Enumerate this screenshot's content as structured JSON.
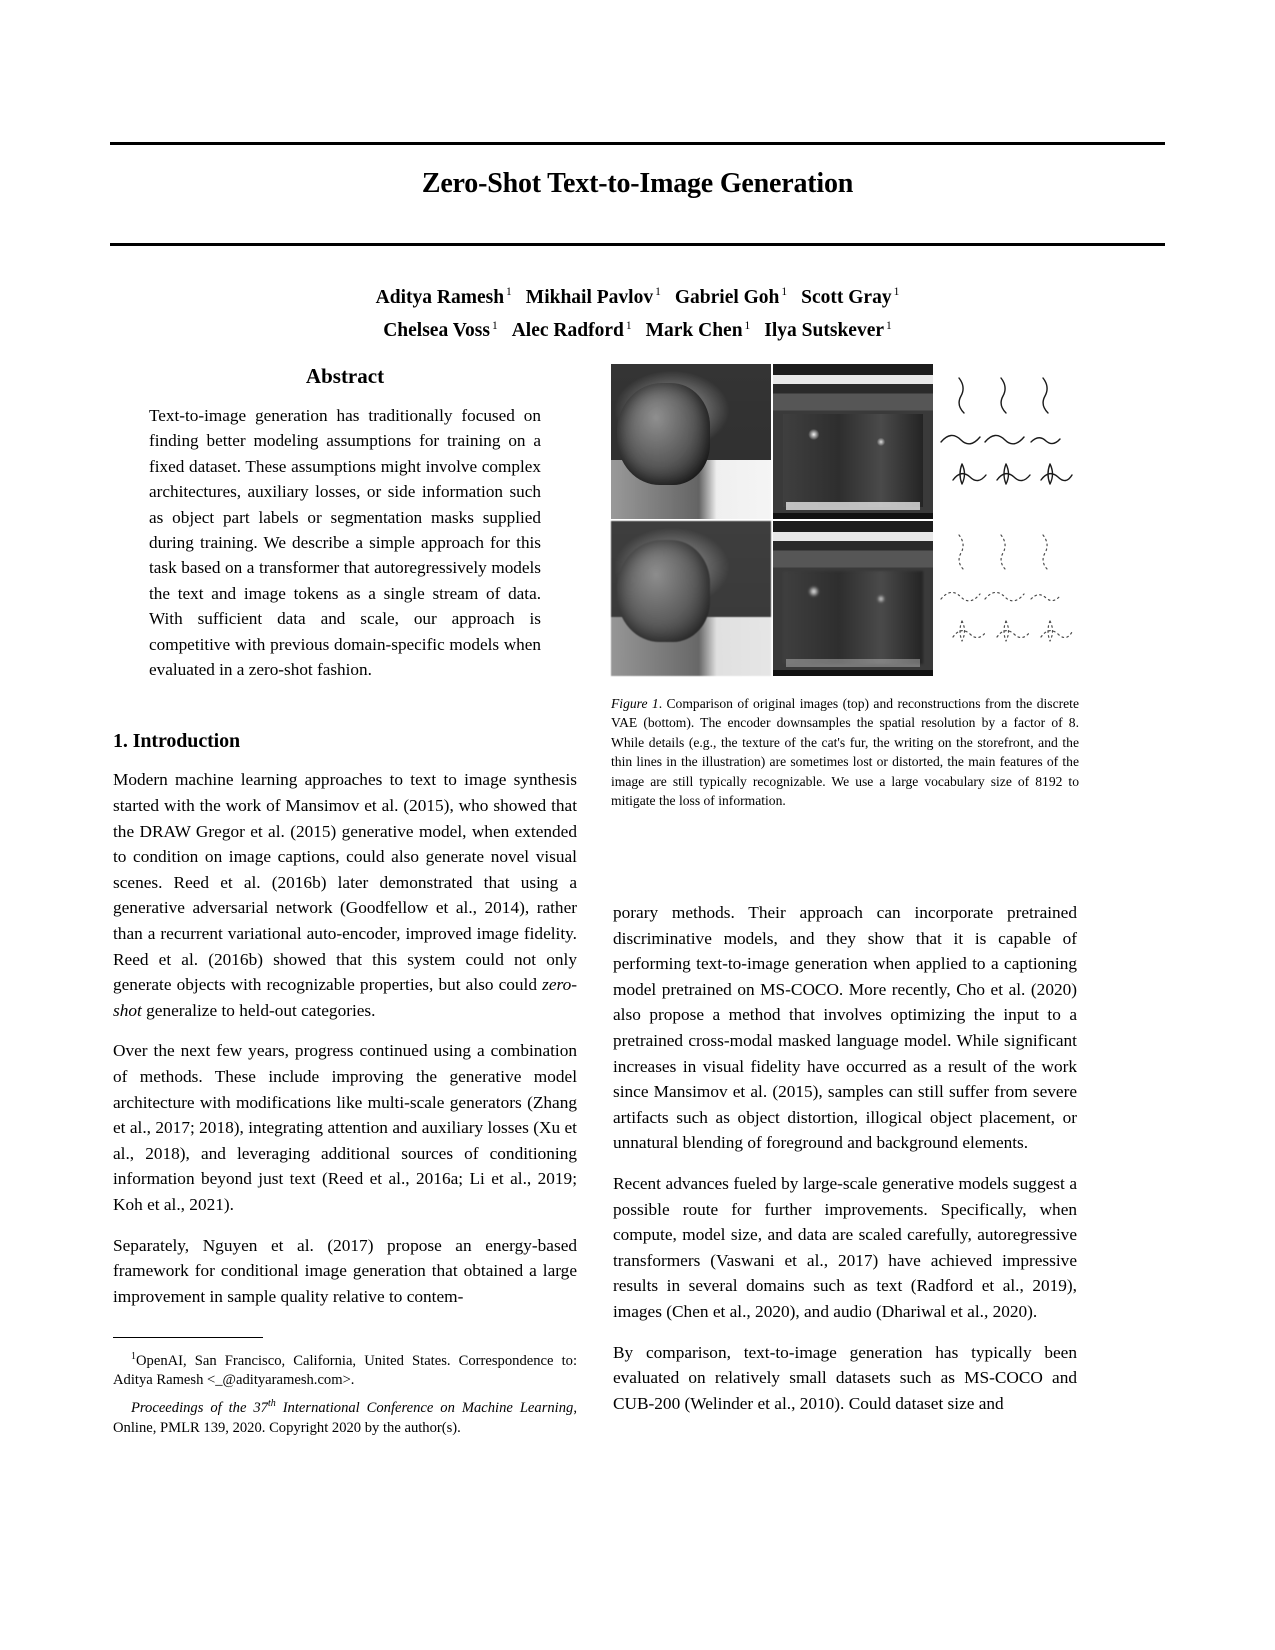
{
  "paper": {
    "title": "Zero-Shot Text-to-Image Generation",
    "authors_line_1": [
      {
        "name": "Aditya Ramesh",
        "affil": "1"
      },
      {
        "name": "Mikhail Pavlov",
        "affil": "1"
      },
      {
        "name": "Gabriel Goh",
        "affil": "1"
      },
      {
        "name": "Scott Gray",
        "affil": "1"
      }
    ],
    "authors_line_2": [
      {
        "name": "Chelsea Voss",
        "affil": "1"
      },
      {
        "name": "Alec Radford",
        "affil": "1"
      },
      {
        "name": "Mark Chen",
        "affil": "1"
      },
      {
        "name": "Ilya Sutskever",
        "affil": "1"
      }
    ]
  },
  "abstract": {
    "heading": "Abstract",
    "text": "Text-to-image generation has traditionally focused on finding better modeling assumptions for training on a fixed dataset. These assumptions might involve complex architectures, auxiliary losses, or side information such as object part labels or segmentation masks supplied during training. We describe a simple approach for this task based on a transformer that autoregressively models the text and image tokens as a single stream of data. With sufficient data and scale, our approach is competitive with previous domain-specific models when evaluated in a zero-shot fashion."
  },
  "introduction": {
    "heading": "1. Introduction",
    "paragraphs": [
      "Modern machine learning approaches to text to image synthesis started with the work of Mansimov et al. (2015), who showed that the DRAW Gregor et al. (2015) generative model, when extended to condition on image captions, could also generate novel visual scenes. Reed et al. (2016b) later demonstrated that using a generative adversarial network (Goodfellow et al., 2014), rather than a recurrent variational auto-encoder, improved image fidelity. Reed et al. (2016b) showed that this system could not only generate objects with recognizable properties, but also could ",
      "Over the next few years, progress continued using a combination of methods. These include improving the generative model architecture with modifications like multi-scale generators (Zhang et al., 2017; 2018), integrating attention and auxiliary losses (Xu et al., 2018), and leveraging additional sources of conditioning information beyond just text (Reed et al., 2016a; Li et al., 2019; Koh et al., 2021).",
      "Separately, Nguyen et al. (2017) propose an energy-based framework for conditional image generation that obtained a large improvement in sample quality relative to contem-"
    ],
    "p1_italic": "zero-shot",
    "p1_tail": " generalize to held-out categories."
  },
  "right_column": {
    "paragraphs": [
      "porary methods. Their approach can incorporate pretrained discriminative models, and they show that it is capable of performing text-to-image generation when applied to a captioning model pretrained on MS-COCO. More recently, Cho et al. (2020) also propose a method that involves optimizing the input to a pretrained cross-modal masked language model. While significant increases in visual fidelity have occurred as a result of the work since Mansimov et al. (2015), samples can still suffer from severe artifacts such as object distortion, illogical object placement, or unnatural blending of foreground and background elements.",
      "Recent advances fueled by large-scale generative models suggest a possible route for further improvements. Specifically, when compute, model size, and data are scaled carefully, autoregressive transformers (Vaswani et al., 2017) have achieved impressive results in several domains such as text (Radford et al., 2019), images (Chen et al., 2020), and audio (Dhariwal et al., 2020).",
      "By comparison, text-to-image generation has typically been evaluated on relatively small datasets such as MS-COCO and CUB-200 (Welinder et al., 2010). Could dataset size and"
    ]
  },
  "figure": {
    "label": "Figure 1",
    "caption": ". Comparison of original images (top) and reconstructions from the discrete VAE (bottom). The encoder downsamples the spatial resolution by a factor of 8. While details (e.g., the texture of the cat's fur, the writing on the storefront, and the thin lines in the illustration) are sometimes lost or distorted, the main features of the image are still typically recognizable. We use a large vocabulary size of 8192 to mitigate the loss of information.",
    "cells": [
      {
        "name": "original-cat",
        "kind": "cat"
      },
      {
        "name": "original-storefront",
        "kind": "store"
      },
      {
        "name": "original-illustration",
        "kind": "illus"
      },
      {
        "name": "reconstruction-cat",
        "kind": "cat-lo"
      },
      {
        "name": "reconstruction-storefront",
        "kind": "store-lo"
      },
      {
        "name": "reconstruction-illustration",
        "kind": "illus-lo"
      }
    ]
  },
  "footnote": {
    "affiliation_marker": "1",
    "affiliation": "OpenAI, San Francisco, California, United States. Correspondence to: Aditya Ramesh <_@adityaramesh.com>.",
    "proceedings_italic_a": "Proceedings of the 37",
    "proceedings_sup": "th",
    "proceedings_italic_b": " International Conference on Machine Learning",
    "proceedings_rest": ", Online, PMLR 139, 2020. Copyright 2020 by the author(s)."
  }
}
